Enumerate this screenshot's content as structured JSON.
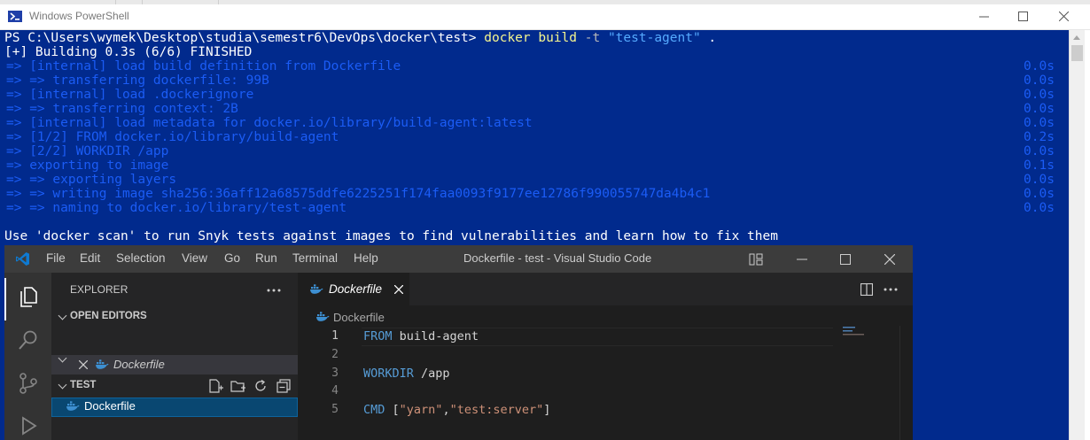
{
  "powershell": {
    "title": "Windows PowerShell",
    "lines": [
      {
        "prompt": "PS C:\\Users\\wymek\\Desktop\\studia\\semestr6\\DevOps\\docker\\test> ",
        "cmd": "docker build",
        "flag": " -t ",
        "str": "\"test-agent\"",
        "rest": " ."
      },
      {
        "text": "[+] Building 0.3s (6/6) FINISHED"
      },
      {
        "text": "=> [internal] load build definition from Dockerfile",
        "time": "0.0s"
      },
      {
        "text": "=> => transferring dockerfile: 99B",
        "time": "0.0s"
      },
      {
        "text": "=> [internal] load .dockerignore",
        "time": "0.0s"
      },
      {
        "text": "=> => transferring context: 2B",
        "time": "0.0s"
      },
      {
        "text": "=> [internal] load metadata for docker.io/library/build-agent:latest",
        "time": "0.0s"
      },
      {
        "text": "=> [1/2] FROM docker.io/library/build-agent",
        "time": "0.2s"
      },
      {
        "text": "=> [2/2] WORKDIR /app",
        "time": "0.0s"
      },
      {
        "text": "=> exporting to image",
        "time": "0.1s"
      },
      {
        "text": "=> => exporting layers",
        "time": "0.0s"
      },
      {
        "text": "=> => writing image sha256:36aff12a68575ddfe6225251f174faa0093f9177ee12786f990055747da4b4c1",
        "time": "0.0s"
      },
      {
        "text": "=> => naming to docker.io/library/test-agent",
        "time": "0.0s"
      },
      {
        "text": ""
      },
      {
        "text": "Use 'docker scan' to run Snyk tests against images to find vulnerabilities and learn how to fix them"
      }
    ]
  },
  "vscode": {
    "menu": [
      "File",
      "Edit",
      "Selection",
      "View",
      "Go",
      "Run",
      "Terminal",
      "Help"
    ],
    "window_title": "Dockerfile - test - Visual Studio Code",
    "sidebar": {
      "header": "EXPLORER",
      "open_editors_label": "OPEN EDITORS",
      "open_editor_file": "Dockerfile",
      "folder_label": "TEST",
      "files": [
        "Dockerfile"
      ]
    },
    "editor": {
      "tab_label": "Dockerfile",
      "breadcrumb": "Dockerfile",
      "line_numbers": [
        "1",
        "2",
        "3",
        "4",
        "5"
      ],
      "code": [
        {
          "kw": "FROM",
          "rest": " build-agent"
        },
        {
          "kw": "",
          "rest": ""
        },
        {
          "kw": "WORKDIR",
          "rest": " /app"
        },
        {
          "kw": "",
          "rest": ""
        },
        {
          "kw": "CMD",
          "pre": " [",
          "s1": "\"yarn\"",
          "mid": ",",
          "s2": "\"test:server\"",
          "post": "]"
        }
      ]
    }
  },
  "colors": {
    "powershell_bg": "#012a8d",
    "vscode_titlebar": "#3c3c3c",
    "vscode_keyword": "#569cd6",
    "vscode_string": "#ce9178"
  }
}
